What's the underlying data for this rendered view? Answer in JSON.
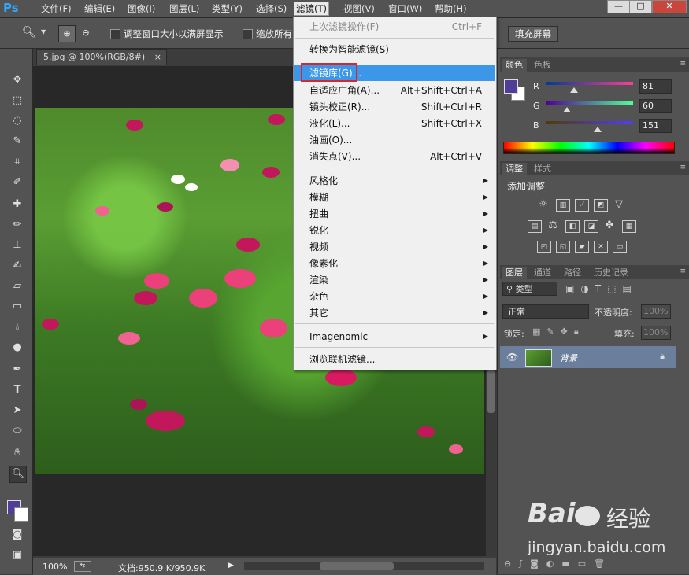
{
  "menubar": {
    "logo": "Ps",
    "items": [
      "文件(F)",
      "编辑(E)",
      "图像(I)",
      "图层(L)",
      "类型(Y)",
      "选择(S)",
      "滤镜(T)",
      "视图(V)",
      "窗口(W)",
      "帮助(H)"
    ],
    "window_buttons": [
      "—",
      "□",
      "✕"
    ]
  },
  "optionsbar": {
    "checkbox1_label": "调整窗口大小以满屏显示",
    "checkbox2_label": "缩放所有",
    "fill_screen_button": "填充屏幕"
  },
  "document": {
    "tab_label": "5.jpg @ 100%(RGB/8#)",
    "tab_close": "×",
    "zoom": "100%",
    "file_info": "文档:950.9 K/950.9K"
  },
  "filter_menu": {
    "last_filter": {
      "label": "上次滤镜操作(F)",
      "shortcut": "Ctrl+F"
    },
    "smart_filter": "转换为智能滤镜(S)",
    "items": [
      {
        "label": "滤镜库(G)...",
        "shortcut": ""
      },
      {
        "label": "自适应广角(A)...",
        "shortcut": "Alt+Shift+Ctrl+A"
      },
      {
        "label": "镜头校正(R)...",
        "shortcut": "Shift+Ctrl+R"
      },
      {
        "label": "液化(L)...",
        "shortcut": "Shift+Ctrl+X"
      },
      {
        "label": "油画(O)...",
        "shortcut": ""
      },
      {
        "label": "消失点(V)...",
        "shortcut": "Alt+Ctrl+V"
      }
    ],
    "submenus": [
      "风格化",
      "模糊",
      "扭曲",
      "锐化",
      "视频",
      "像素化",
      "渲染",
      "杂色",
      "其它"
    ],
    "imagenomic": "Imagenomic",
    "browse_online": "浏览联机滤镜..."
  },
  "color_panel": {
    "tabs": [
      "颜色",
      "色板"
    ],
    "channels": [
      {
        "name": "R",
        "value": "81",
        "fraction": 0.318
      },
      {
        "name": "G",
        "value": "60",
        "fraction": 0.235
      },
      {
        "name": "B",
        "value": "151",
        "fraction": 0.592
      }
    ],
    "foreground": "#513c97"
  },
  "adjust_panel": {
    "tabs": [
      "调整",
      "样式"
    ],
    "title": "添加调整"
  },
  "layers_panel": {
    "tabs": [
      "图层",
      "通道",
      "路径",
      "历史记录"
    ],
    "filter_label": "类型",
    "blend_mode": "正常",
    "opacity_label": "不透明度:",
    "opacity_value": "100%",
    "lock_label": "锁定:",
    "fill_label": "填充:",
    "fill_value": "100%",
    "layer_name": "背景"
  },
  "watermark": {
    "brand": "Bai",
    "brand2": "经验",
    "url": "jingyan.baidu.com"
  }
}
